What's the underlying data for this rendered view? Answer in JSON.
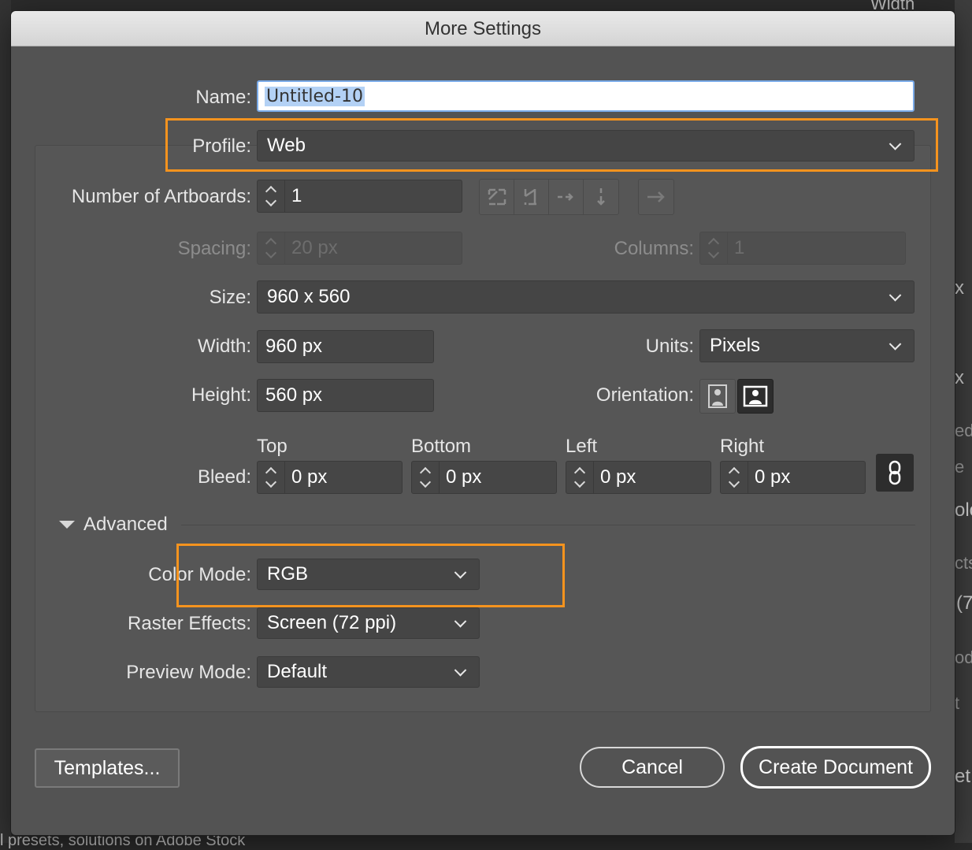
{
  "dialog": {
    "title": "More Settings"
  },
  "background": {
    "fragments": [
      "Width",
      "x",
      "x",
      "ed",
      "e",
      "olc",
      "cts",
      "(7",
      "od",
      "t",
      "et",
      "l presets, solutions on Adobe Stock"
    ]
  },
  "fields": {
    "name": {
      "label": "Name:",
      "value": "Untitled-10"
    },
    "profile": {
      "label": "Profile:",
      "value": "Web"
    },
    "artboards": {
      "label": "Number of Artboards:",
      "value": "1"
    },
    "spacing": {
      "label": "Spacing:",
      "value": "20 px"
    },
    "columns": {
      "label": "Columns:",
      "value": "1"
    },
    "size": {
      "label": "Size:",
      "value": "960 x 560"
    },
    "width": {
      "label": "Width:",
      "value": "960 px"
    },
    "units": {
      "label": "Units:",
      "value": "Pixels"
    },
    "height": {
      "label": "Height:",
      "value": "560 px"
    },
    "orientation": {
      "label": "Orientation:",
      "selected": "landscape"
    },
    "bleed": {
      "label": "Bleed:",
      "top": {
        "label": "Top",
        "value": "0 px"
      },
      "bottom": {
        "label": "Bottom",
        "value": "0 px"
      },
      "left": {
        "label": "Left",
        "value": "0 px"
      },
      "right": {
        "label": "Right",
        "value": "0 px"
      },
      "link_icon": "link-icon"
    }
  },
  "advanced": {
    "label": "Advanced",
    "color_mode": {
      "label": "Color Mode:",
      "value": "RGB"
    },
    "raster_effects": {
      "label": "Raster Effects:",
      "value": "Screen (72 ppi)"
    },
    "preview_mode": {
      "label": "Preview Mode:",
      "value": "Default"
    }
  },
  "buttons": {
    "templates": "Templates...",
    "cancel": "Cancel",
    "create": "Create Document"
  },
  "colors": {
    "highlight": "#f5931e",
    "dialog_bg": "#535353",
    "field_bg": "#454545"
  }
}
